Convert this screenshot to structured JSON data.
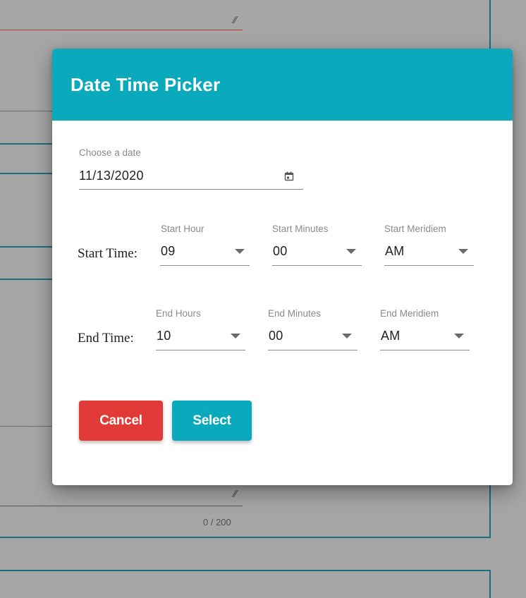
{
  "dialog": {
    "title": "Date Time Picker",
    "date": {
      "label": "Choose a date",
      "value": "11/13/2020",
      "icon": "calendar-icon"
    },
    "start": {
      "row_label": "Start Time:",
      "hour": {
        "label": "Start Hour",
        "value": "09"
      },
      "minutes": {
        "label": "Start Minutes",
        "value": "00"
      },
      "meridiem": {
        "label": "Start Meridiem",
        "value": "AM"
      }
    },
    "end": {
      "row_label": "End Time:",
      "hour": {
        "label": "End Hours",
        "value": "10"
      },
      "minutes": {
        "label": "End Minutes",
        "value": "00"
      },
      "meridiem": {
        "label": "End Meridiem",
        "value": "AM"
      }
    },
    "buttons": {
      "cancel": "Cancel",
      "select": "Select"
    }
  },
  "background": {
    "char_counter": "0 / 200"
  },
  "colors": {
    "accent": "#0aa9bb",
    "danger": "#e23b37",
    "backdrop": "#a6a6a6",
    "background_line_teal": "#19707c",
    "background_line_red": "#c0392b"
  }
}
